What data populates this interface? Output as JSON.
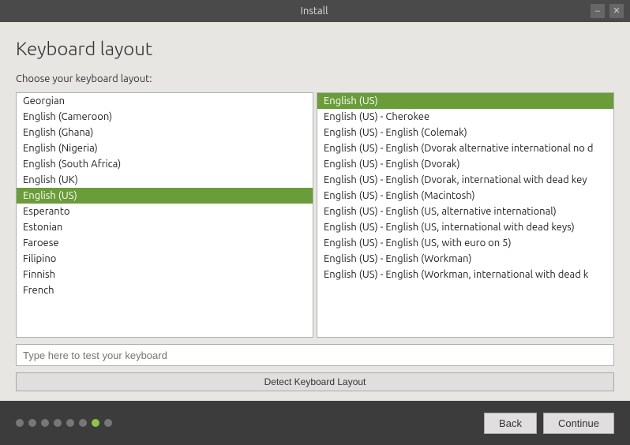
{
  "titlebar": {
    "title": "Install",
    "minimize_label": "–",
    "close_label": "✕"
  },
  "page": {
    "heading": "Keyboard layout",
    "subtitle": "Choose your keyboard layout:"
  },
  "left_list": {
    "items": [
      {
        "label": "Georgian",
        "selected": false
      },
      {
        "label": "English (Cameroon)",
        "selected": false
      },
      {
        "label": "English (Ghana)",
        "selected": false
      },
      {
        "label": "English (Nigeria)",
        "selected": false
      },
      {
        "label": "English (South Africa)",
        "selected": false
      },
      {
        "label": "English (UK)",
        "selected": false
      },
      {
        "label": "English (US)",
        "selected": true
      },
      {
        "label": "Esperanto",
        "selected": false
      },
      {
        "label": "Estonian",
        "selected": false
      },
      {
        "label": "Faroese",
        "selected": false
      },
      {
        "label": "Filipino",
        "selected": false
      },
      {
        "label": "Finnish",
        "selected": false
      },
      {
        "label": "French",
        "selected": false
      }
    ]
  },
  "right_list": {
    "items": [
      {
        "label": "English (US)",
        "selected": true
      },
      {
        "label": "English (US) - Cherokee",
        "selected": false
      },
      {
        "label": "English (US) - English (Colemak)",
        "selected": false
      },
      {
        "label": "English (US) - English (Dvorak alternative international no d",
        "selected": false
      },
      {
        "label": "English (US) - English (Dvorak)",
        "selected": false
      },
      {
        "label": "English (US) - English (Dvorak, international with dead key",
        "selected": false
      },
      {
        "label": "English (US) - English (Macintosh)",
        "selected": false
      },
      {
        "label": "English (US) - English (US, alternative international)",
        "selected": false
      },
      {
        "label": "English (US) - English (US, international with dead keys)",
        "selected": false
      },
      {
        "label": "English (US) - English (US, with euro on 5)",
        "selected": false
      },
      {
        "label": "English (US) - English (Workman)",
        "selected": false
      },
      {
        "label": "English (US) - English (Workman, international with dead k",
        "selected": false
      }
    ]
  },
  "test_input": {
    "placeholder": "Type here to test your keyboard"
  },
  "detect_button": {
    "label": "Detect Keyboard Layout"
  },
  "nav": {
    "back_label": "Back",
    "continue_label": "Continue"
  },
  "progress": {
    "total_dots": 8,
    "active_dot": 7
  }
}
